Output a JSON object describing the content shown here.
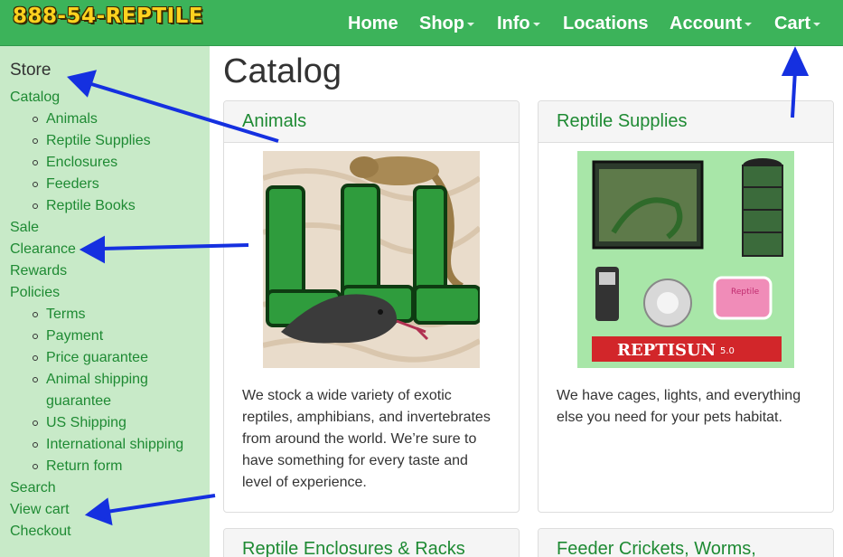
{
  "header": {
    "logo_text": "888-54-REPTILE",
    "nav": [
      {
        "label": "Home"
      },
      {
        "label": "Shop"
      },
      {
        "label": "Info"
      },
      {
        "label": "Locations"
      },
      {
        "label": "Account"
      },
      {
        "label": "Cart"
      }
    ]
  },
  "sidebar": {
    "heading": "Store",
    "catalog": "Catalog",
    "catalog_items": [
      "Animals",
      "Reptile Supplies",
      "Enclosures",
      "Feeders",
      "Reptile Books"
    ],
    "sale": "Sale",
    "clearance": "Clearance",
    "rewards": "Rewards",
    "policies": "Policies",
    "policy_items": [
      "Terms",
      "Payment",
      "Price guarantee",
      "Animal shipping",
      "guarantee",
      "US Shipping",
      "International shipping",
      "Return form"
    ],
    "search": "Search",
    "view_cart": "View cart",
    "checkout": "Checkout"
  },
  "main": {
    "title": "Catalog",
    "cards": [
      {
        "title": "Animals",
        "lines": [
          "We stock a wide variety of exotic",
          "reptiles, amphibians, and invertebrates",
          "from around the world. We’re sure to",
          "have something for every taste and",
          "level of experience."
        ]
      },
      {
        "title": "Reptile Supplies",
        "lines": [
          "We have cages, lights, and everything",
          "else you need for your pets habitat."
        ]
      },
      {
        "title": "Reptile Enclosures & Racks"
      },
      {
        "title": "Feeder Crickets, Worms,"
      }
    ],
    "image_texts": {
      "reptisun": "REPTISUN",
      "reptisun_version": "5.0",
      "jar_label": "Reptile"
    }
  },
  "colors": {
    "navbar": "#3cb35a",
    "sidebar": "#c8eac8",
    "link": "#1e8a33",
    "annotation_arrow": "#1530e0"
  }
}
